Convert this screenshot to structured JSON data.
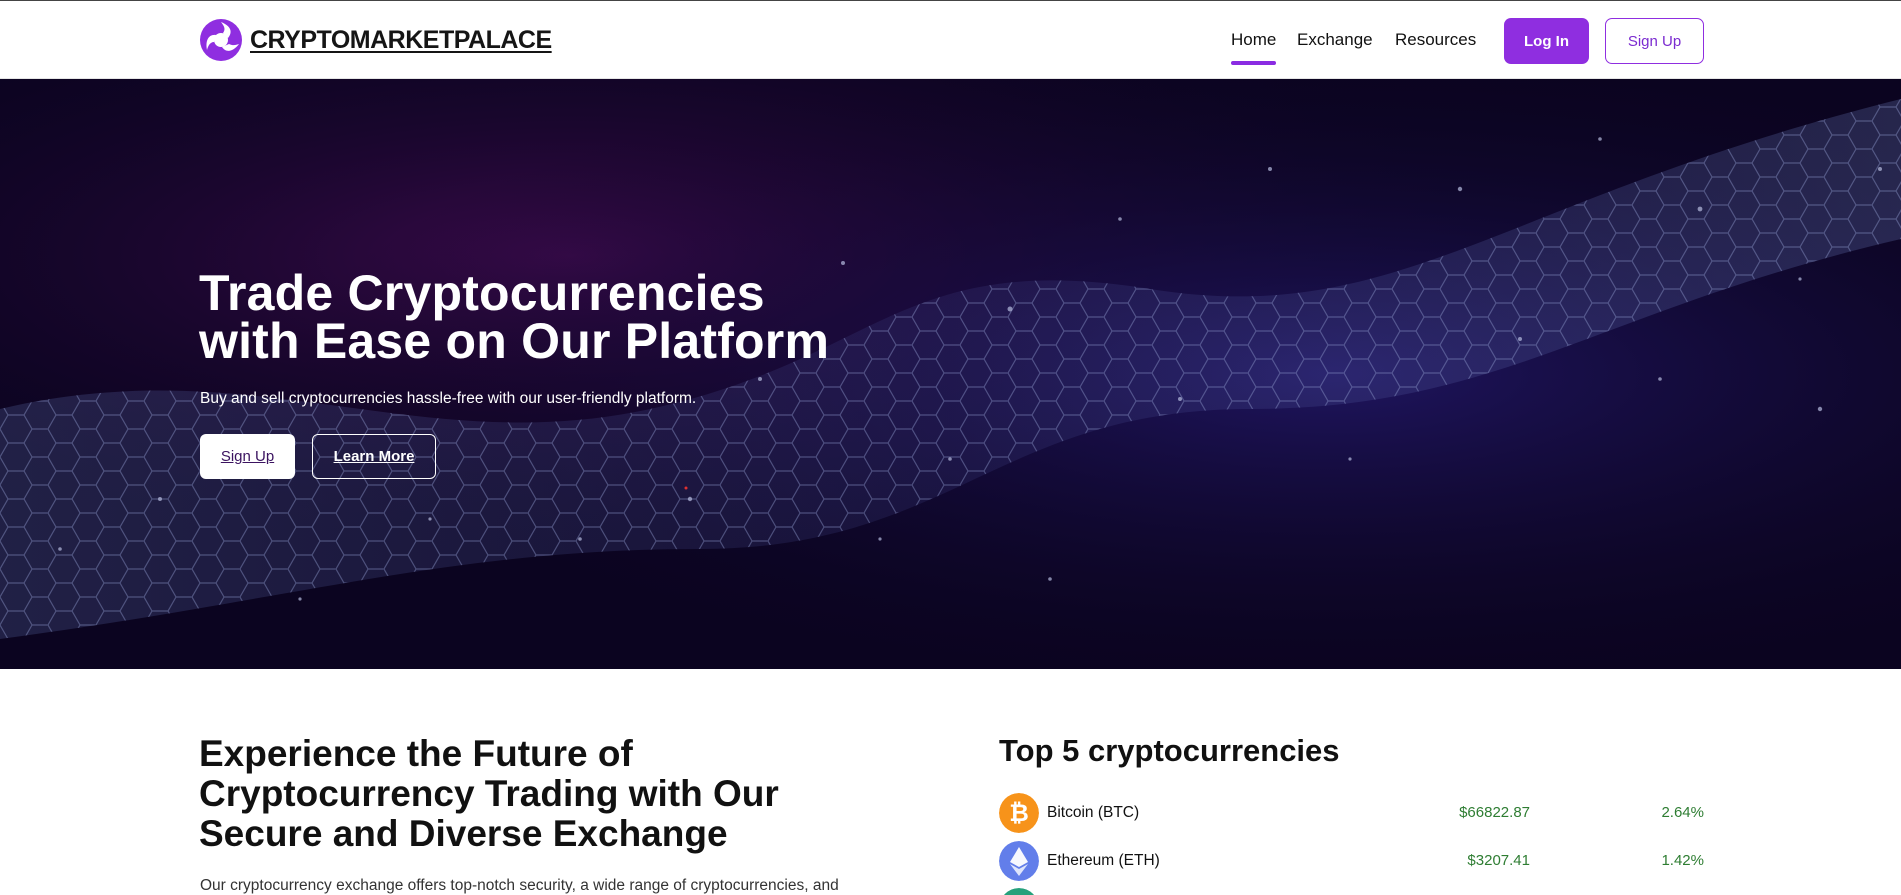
{
  "header": {
    "brand": "CRYPTOMARKETPALACE",
    "nav": [
      {
        "label": "Home",
        "active": true
      },
      {
        "label": "Exchange",
        "active": false
      },
      {
        "label": "Resources",
        "active": false
      }
    ],
    "login_label": "Log In",
    "signup_label": "Sign Up"
  },
  "hero": {
    "title_line1": "Trade Cryptocurrencies",
    "title_line2": "with Ease on Our Platform",
    "subtitle": "Buy and sell cryptocurrencies hassle-free with our user-friendly platform.",
    "signup_label": "Sign Up",
    "learn_more_label": "Learn More"
  },
  "features": {
    "title": "Experience the Future of Cryptocurrency Trading with Our Secure and Diverse Exchange",
    "description": "Our cryptocurrency exchange offers top-notch security, a wide range of cryptocurrencies, and"
  },
  "top5": {
    "title": "Top 5 cryptocurrencies",
    "coins": [
      {
        "name": "Bitcoin (BTC)",
        "price": "$66822.87",
        "change": "2.64%",
        "icon": "bitcoin-icon",
        "color": "#f7931a"
      },
      {
        "name": "Ethereum (ETH)",
        "price": "$3207.41",
        "change": "1.42%",
        "icon": "ethereum-icon",
        "color": "#627eea"
      },
      {
        "name": "",
        "price": "",
        "change": "",
        "icon": "coin-icon",
        "color": "#26a17b"
      }
    ]
  },
  "colors": {
    "accent": "#8f2ee0",
    "positive": "#2e7d32",
    "hero_bg": "#0d0524"
  }
}
